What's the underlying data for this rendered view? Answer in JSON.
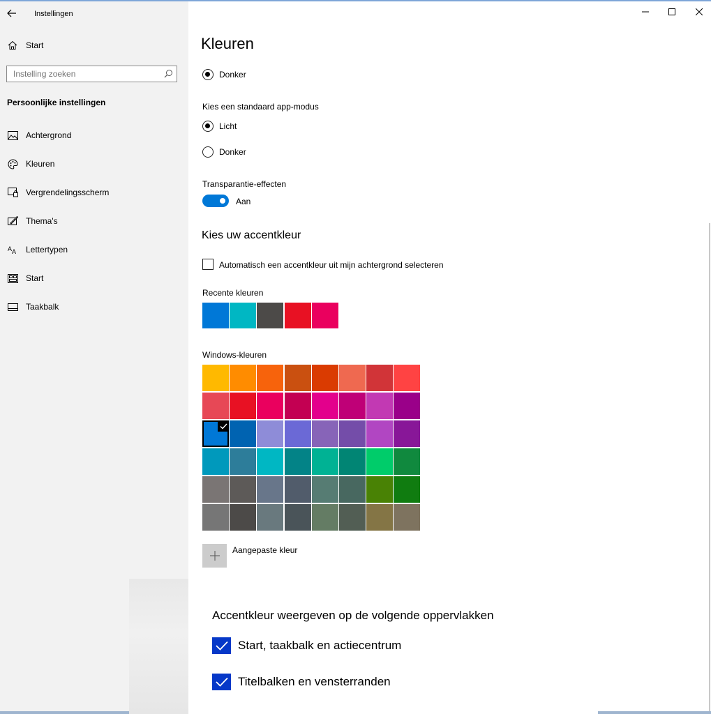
{
  "window": {
    "title": "Instellingen"
  },
  "sidebar": {
    "home_label": "Start",
    "search_placeholder": "Instelling zoeken",
    "section_title": "Persoonlijke instellingen",
    "items": [
      {
        "label": "Achtergrond",
        "icon": "picture-icon"
      },
      {
        "label": "Kleuren",
        "icon": "palette-icon"
      },
      {
        "label": "Vergrendelingsscherm",
        "icon": "lock-screen-icon"
      },
      {
        "label": "Thema's",
        "icon": "theme-icon"
      },
      {
        "label": "Lettertypen",
        "icon": "font-icon"
      },
      {
        "label": "Start",
        "icon": "start-icon"
      },
      {
        "label": "Taakbalk",
        "icon": "taskbar-icon"
      }
    ]
  },
  "main": {
    "title": "Kleuren",
    "windows_mode_selected_label": "Donker",
    "app_mode_heading": "Kies een standaard app-modus",
    "app_mode_options": [
      {
        "label": "Licht",
        "selected": true
      },
      {
        "label": "Donker",
        "selected": false
      }
    ],
    "transparency_heading": "Transparantie-effecten",
    "transparency_state": "Aan",
    "accent_heading": "Kies uw accentkleur",
    "auto_accent_label": "Automatisch een accentkleur uit mijn achtergrond selecteren",
    "auto_accent_checked": false,
    "recent_heading": "Recente kleuren",
    "recent_colors": [
      "#0078d7",
      "#00b7c3",
      "#4c4a48",
      "#e81123",
      "#ea005e"
    ],
    "windows_colors_heading": "Windows-kleuren",
    "windows_colors": [
      [
        "#ffb900",
        "#ff8c00",
        "#f7630c",
        "#ca5010",
        "#da3b01",
        "#ef6950",
        "#d13438",
        "#ff4343"
      ],
      [
        "#e74856",
        "#e81123",
        "#ea005e",
        "#c30052",
        "#e3008c",
        "#bf0077",
        "#c239b3",
        "#9a0089"
      ],
      [
        "#0078d7",
        "#0063b1",
        "#8e8cd8",
        "#6b69d6",
        "#8764b8",
        "#744da9",
        "#b146c2",
        "#881798"
      ],
      [
        "#0099bc",
        "#2d7d9a",
        "#00b7c3",
        "#038387",
        "#00b294",
        "#018574",
        "#00cc6a",
        "#10893e"
      ],
      [
        "#7a7574",
        "#5d5a58",
        "#68768a",
        "#515c6b",
        "#567c73",
        "#486860",
        "#498205",
        "#107c10"
      ],
      [
        "#767676",
        "#4c4a48",
        "#69797e",
        "#4a5459",
        "#647c64",
        "#525e54",
        "#847545",
        "#7e735f"
      ]
    ],
    "selected_color": "#0078d7",
    "custom_color_label": "Aangepaste kleur"
  },
  "popup": {
    "title": "Accentkleur weergeven op de volgende oppervlakken",
    "options": [
      {
        "label": "Start, taakbalk en actiecentrum",
        "checked": true
      },
      {
        "label": "Titelbalken en vensterranden",
        "checked": true
      }
    ]
  },
  "colors": {
    "accent": "#0078d7",
    "checkbox_blue": "#0638c8",
    "sidebar_bg": "#f2f2f2"
  }
}
